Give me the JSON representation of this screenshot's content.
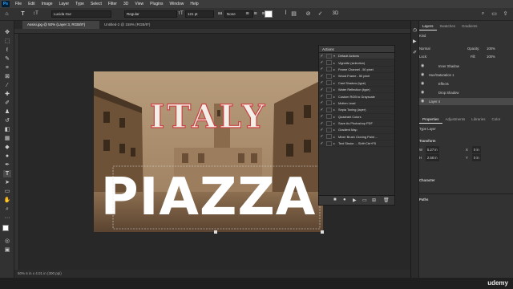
{
  "app": {
    "logo": "Ps"
  },
  "menu": [
    "File",
    "Edit",
    "Image",
    "Layer",
    "Type",
    "Select",
    "Filter",
    "3D",
    "View",
    "Plugins",
    "Window",
    "Help"
  ],
  "options": {
    "font_family": "Lucida Gur",
    "font_style": "Regular",
    "font_size": "121 pt",
    "antialias": "None",
    "color": "#ffffff"
  },
  "tabs": [
    {
      "label": "Assisi.jpg @ 50% (Layer 3, RGB/8*)",
      "active": true
    },
    {
      "label": "Untitled-2 @ 158% (RGB/8*)",
      "active": false
    }
  ],
  "canvas": {
    "headline_top": "ITALY",
    "headline_bottom": "PIAZZA",
    "status": "50%   6 in x 4.01 in (300 ppi)"
  },
  "actions_panel": {
    "title": "Actions",
    "set_name": "Default Actions",
    "items": [
      "Vignette (selection)",
      "Frame Channel - 50 pixel",
      "Wood Frame - 50 pixel",
      "Cast Shadow (type)",
      "Water Reflection (type)",
      "Custom RGB to Grayscale",
      "Molten Lead",
      "Sepia Toning (layer)",
      "Quadrant Colors",
      "Save As Photoshop PDF",
      "Gradient Map",
      "Mixer Brush Cloning Paint ...",
      "Text Stroke ...     Shft+Ctrl+F5"
    ]
  },
  "layers_panel": {
    "tabs": [
      "Layers",
      "Swatches",
      "Gradients"
    ],
    "kind": "Kind",
    "blend": "Normal",
    "opacity_label": "Opacity:",
    "opacity": "100%",
    "lock_label": "Lock:",
    "fill_label": "Fill:",
    "fill": "100%",
    "rows": [
      {
        "name": "Inner Shadow",
        "indent": true
      },
      {
        "name": "Hue/Saturation 1",
        "indent": false
      },
      {
        "name": "Effects",
        "indent": true
      },
      {
        "name": "Drop Shadow",
        "indent": true
      },
      {
        "name": "Layer 4",
        "indent": false
      }
    ]
  },
  "properties_panel": {
    "tabs": [
      "Properties",
      "Adjustments",
      "Libraries",
      "Color"
    ],
    "type_label": "Type Layer",
    "transform_title": "Transform",
    "w_label": "W",
    "w_value": "5.27 in",
    "h_label": "H",
    "h_value": "2.58 in",
    "x_label": "X",
    "x_value": "0 in",
    "y_label": "Y",
    "y_value": "0 in",
    "character_title": "Character",
    "paths_title": "Paths"
  },
  "taskbar": {
    "watermark": "udemy"
  },
  "colors": {
    "accent": "#31a8ff",
    "canvas_bg": "#282828",
    "panel_bg": "#323232"
  }
}
